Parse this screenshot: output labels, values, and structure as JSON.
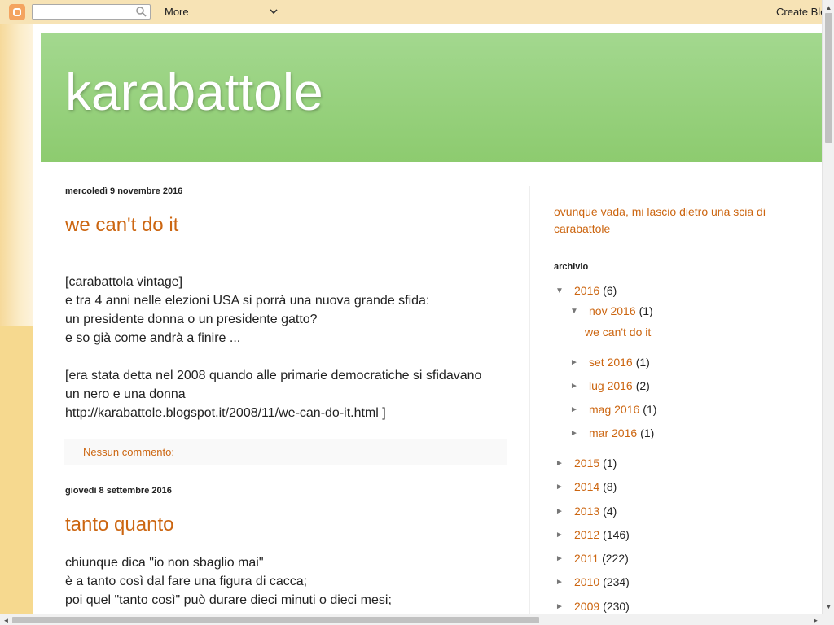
{
  "navbar": {
    "more_label": "More",
    "create_label": "Create Blog",
    "search_placeholder": "",
    "icons": {
      "logo": "blogger-logo",
      "search": "search-icon",
      "chevron": "chevron-down-icon"
    }
  },
  "blog": {
    "title": "karabattole"
  },
  "posts": [
    {
      "date": "mercoledì 9 novembre 2016",
      "title": "we can't do it",
      "lines": [
        "[carabattola vintage]",
        "e tra 4 anni nelle elezioni USA si porrà una nuova grande sfida:",
        "un presidente donna o un presidente gatto?",
        "e so già come andrà a finire ...",
        "",
        "[era stata detta nel 2008 quando alle primarie democratiche si sfidavano",
        "un nero e una donna",
        "http://karabattole.blogspot.it/2008/11/we-can-do-it.html ]"
      ],
      "comments_label": "Nessun commento:"
    },
    {
      "date": "giovedì 8 settembre 2016",
      "title": "tanto quanto",
      "lines": [
        "chiunque dica \"io non sbaglio mai\"",
        "è a tanto così dal fare una figura di cacca;",
        "poi quel \"tanto così\" può durare dieci minuti o dieci mesi;"
      ]
    }
  ],
  "sidebar": {
    "description": "ovunque vada, mi lascio dietro una scia di carabattole",
    "archive_title": "archivio",
    "archive": [
      {
        "toggle": "▼",
        "label": "2016",
        "count": "(6)"
      },
      {
        "toggle": "▼",
        "label": "nov 2016",
        "count": "(1)"
      },
      {
        "post": "we can't do it"
      },
      {
        "toggle": "►",
        "label": "set 2016",
        "count": "(1)"
      },
      {
        "toggle": "►",
        "label": "lug 2016",
        "count": "(2)"
      },
      {
        "toggle": "►",
        "label": "mag 2016",
        "count": "(1)"
      },
      {
        "toggle": "►",
        "label": "mar 2016",
        "count": "(1)"
      },
      {
        "toggle": "►",
        "label": "2015",
        "count": "(1)"
      },
      {
        "toggle": "►",
        "label": "2014",
        "count": "(8)"
      },
      {
        "toggle": "►",
        "label": "2013",
        "count": "(4)"
      },
      {
        "toggle": "►",
        "label": "2012",
        "count": "(146)"
      },
      {
        "toggle": "►",
        "label": "2011",
        "count": "(222)"
      },
      {
        "toggle": "►",
        "label": "2010",
        "count": "(234)"
      },
      {
        "toggle": "►",
        "label": "2009",
        "count": "(230)"
      }
    ]
  },
  "scrollbars": {
    "up_arrow": "▲",
    "down_arrow": "▼",
    "left_arrow": "◄",
    "right_arrow": "►"
  }
}
